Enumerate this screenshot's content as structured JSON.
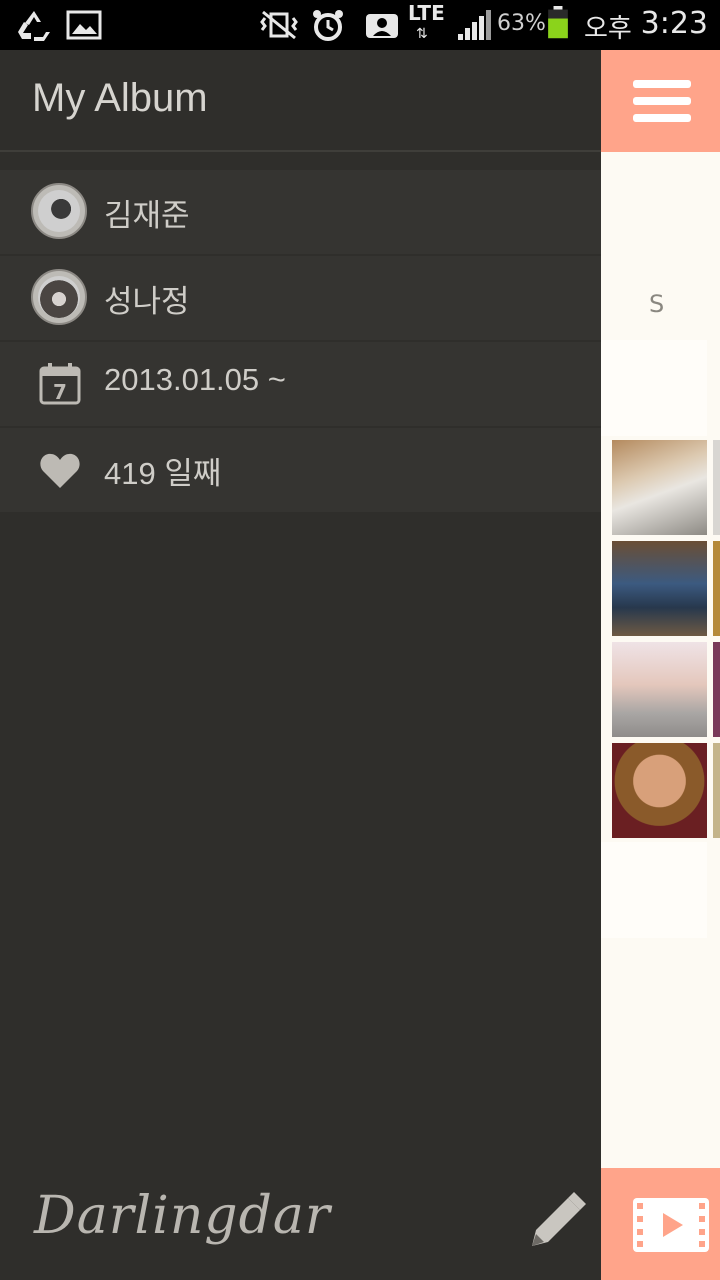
{
  "status_bar": {
    "battery_percent": "63%",
    "ampm": "오후",
    "time": "3:23",
    "network": "LTE"
  },
  "drawer": {
    "title": "My Album",
    "items": [
      {
        "icon": "avatar-male",
        "label": "김재준"
      },
      {
        "icon": "avatar-female",
        "label": "성나정"
      },
      {
        "icon": "calendar-icon",
        "label": "2013.01.05 ~"
      },
      {
        "icon": "heart-icon",
        "label": "419 일째"
      }
    ],
    "logo": "Darlingdar"
  },
  "content": {
    "section_letter": "S"
  },
  "colors": {
    "accent": "#ffa48a",
    "drawer_bg": "#2f2e2b",
    "item_bg": "#353431"
  }
}
